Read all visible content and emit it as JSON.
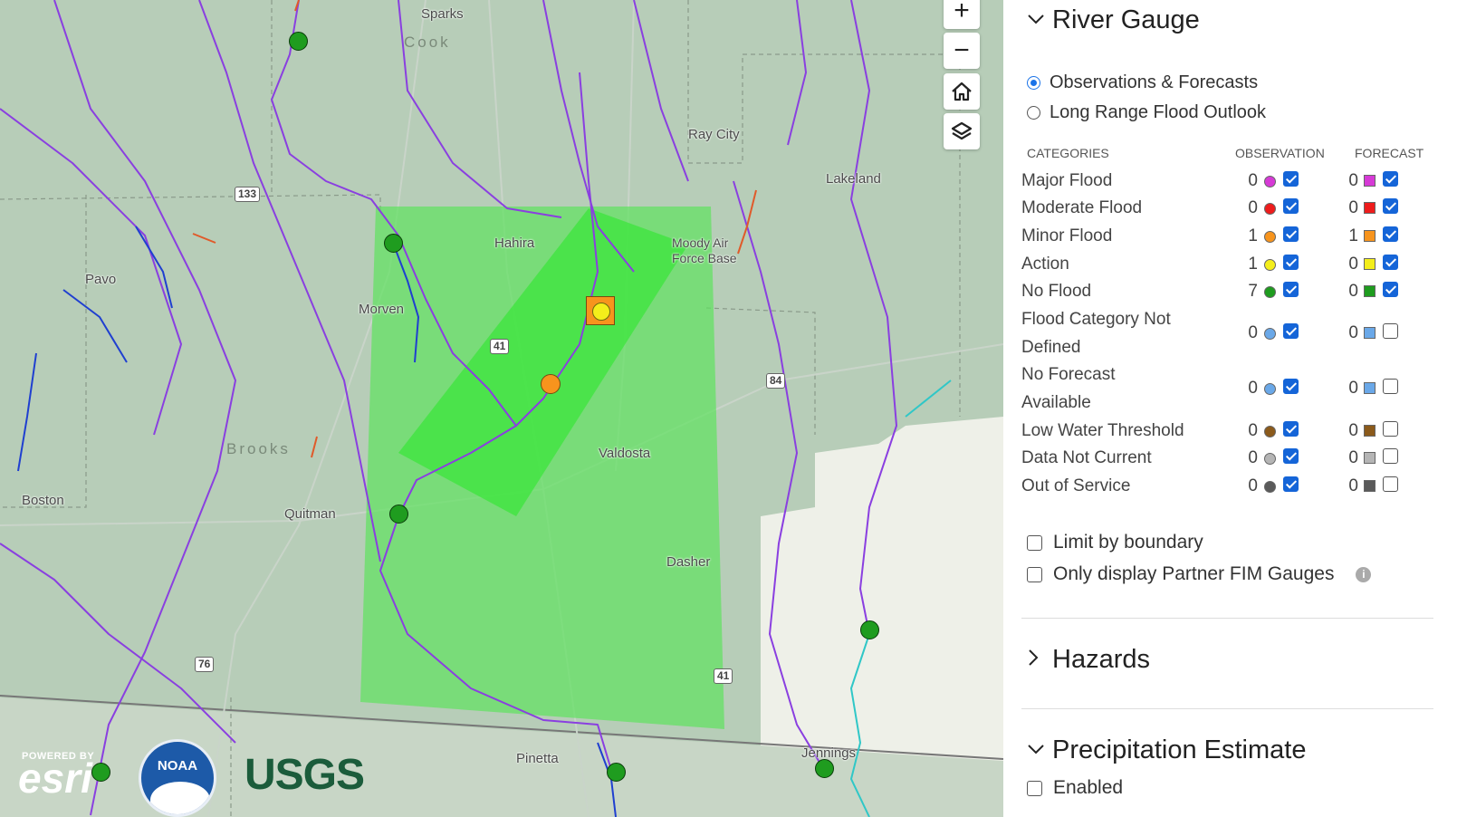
{
  "map": {
    "places": {
      "sparks": "Sparks",
      "ray_city": "Ray City",
      "lakeland": "Lakeland",
      "hahira": "Hahira",
      "moody_afb": "Moody Air\nForce Base",
      "pavo": "Pavo",
      "morven": "Morven",
      "valdosta": "Valdosta",
      "boston": "Boston",
      "quitman": "Quitman",
      "dasher": "Dasher",
      "pinetta": "Pinetta",
      "jennings": "Jennings"
    },
    "counties": {
      "cook": "Cook",
      "brooks": "Brooks"
    },
    "shields": {
      "r133": "133",
      "r84": "84",
      "r41a": "41",
      "r41b": "41",
      "r76": "76"
    },
    "controls": {
      "zoom_in": "+",
      "zoom_out": "−"
    },
    "logos": {
      "esri_powered": "POWERED BY",
      "esri": "esri",
      "noaa": "NOAA",
      "usgs": "USGS"
    }
  },
  "panel": {
    "river_gauge": {
      "title": "River Gauge",
      "options": [
        {
          "label": "Observations & Forecasts",
          "selected": true
        },
        {
          "label": "Long Range Flood Outlook",
          "selected": false
        }
      ],
      "columns": {
        "categories": "CATEGORIES",
        "observation": "OBSERVATION",
        "forecast": "FORECAST"
      },
      "categories": [
        {
          "label": "Major Flood",
          "obs_count": "0",
          "obs_color": "#d63ad6",
          "obs_checked": true,
          "fc_count": "0",
          "fc_color": "#d63ad6",
          "fc_checked": true
        },
        {
          "label": "Moderate Flood",
          "obs_count": "0",
          "obs_color": "#ee1c1c",
          "obs_checked": true,
          "fc_count": "0",
          "fc_color": "#ee1c1c",
          "fc_checked": true
        },
        {
          "label": "Minor Flood",
          "obs_count": "1",
          "obs_color": "#f7941d",
          "obs_checked": true,
          "fc_count": "1",
          "fc_color": "#f7941d",
          "fc_checked": true
        },
        {
          "label": "Action",
          "obs_count": "1",
          "obs_color": "#f4ee1b",
          "obs_checked": true,
          "fc_count": "0",
          "fc_color": "#f4ee1b",
          "fc_checked": true
        },
        {
          "label": "No Flood",
          "obs_count": "7",
          "obs_color": "#1f9c1f",
          "obs_checked": true,
          "fc_count": "0",
          "fc_color": "#1f9c1f",
          "fc_checked": true
        },
        {
          "label": "Flood Category Not",
          "label2": "Defined",
          "obs_count": "0",
          "obs_color": "#6aa8e8",
          "obs_checked": true,
          "fc_count": "0",
          "fc_color": "#6aa8e8",
          "fc_checked": false
        },
        {
          "label": "No Forecast",
          "label2": "Available",
          "obs_count": "0",
          "obs_color": "#6aa8e8",
          "obs_checked": true,
          "fc_count": "0",
          "fc_color": "#6aa8e8",
          "fc_checked": false
        },
        {
          "label": "Low Water Threshold",
          "obs_count": "0",
          "obs_color": "#8b5a1b",
          "obs_checked": true,
          "fc_count": "0",
          "fc_color": "#8b5a1b",
          "fc_checked": false
        },
        {
          "label": "Data Not Current",
          "obs_count": "0",
          "obs_color": "#b5b5b5",
          "obs_checked": true,
          "fc_count": "0",
          "fc_color": "#b5b5b5",
          "fc_checked": false
        },
        {
          "label": "Out of Service",
          "obs_count": "0",
          "obs_color": "#5a5a5a",
          "obs_checked": true,
          "fc_count": "0",
          "fc_color": "#5a5a5a",
          "fc_checked": false
        }
      ],
      "limit_by_boundary": "Limit by boundary",
      "partner_fim": "Only display Partner FIM Gauges",
      "info_glyph": "i"
    },
    "hazards": {
      "title": "Hazards"
    },
    "precipitation": {
      "title": "Precipitation Estimate",
      "enabled": "Enabled"
    }
  }
}
